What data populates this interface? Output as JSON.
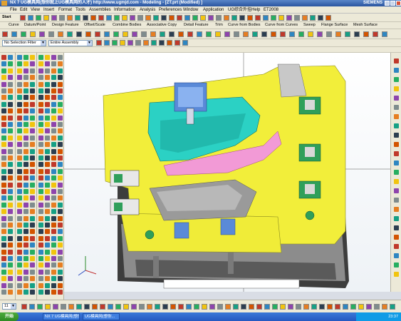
{
  "window": {
    "title": "NX 7 UG模具网(想你就上UG模具网的人才) http://www.ugmjd.com - Modeling - [ZT.prt (Modified) ]",
    "brand": "SIEMENS"
  },
  "menu": [
    "File",
    "Edit",
    "View",
    "Insert",
    "Format",
    "Tools",
    "Assemblies",
    "Information",
    "Analysis",
    "Preferences",
    "Window",
    "Application",
    "UG综合外挂",
    "Help",
    "ET2008"
  ],
  "toolbar": {
    "start_label": "Start",
    "feature_labels": [
      "Curve",
      "Datum/Point",
      "Design Feature",
      "Offset/Scale",
      "Combine Bodies",
      "Associative Copy",
      "Detail Feature",
      "Trim",
      "Curve from Bodies",
      "Curve from Curves",
      "Sweep",
      "Flange Surface",
      "Mesh Surface"
    ]
  },
  "filter": {
    "selection_filter": "No Selection Filter",
    "scope": "Entire Assembly"
  },
  "status": {
    "bottom_value": "11"
  },
  "taskbar": {
    "start": "开始",
    "tasks": [
      "NX 7 UG模具网(想你...",
      "UG模具网(想你..."
    ],
    "clock": "23:37"
  },
  "colors": {
    "mold_yellow": "#f2ee3a",
    "mold_cyan": "#2bd1c4",
    "mold_pink": "#f29ad6",
    "steel_gray": "#9a9a9a",
    "slide_blue": "#5a8ad8",
    "bracket_green": "#2f9f5a"
  }
}
